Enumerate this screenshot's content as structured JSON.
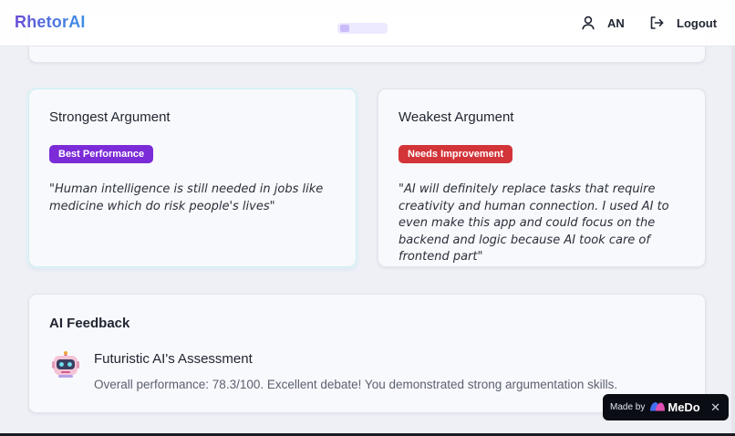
{
  "navbar": {
    "brand": "RhetorAI",
    "user_icon": "user-icon",
    "user_initials": "AN",
    "logout_icon": "logout-icon",
    "logout_label": "Logout"
  },
  "strongest": {
    "title": "Strongest Argument",
    "badge": "Best Performance",
    "badge_color": "#7c2bd8",
    "quote": "\"Human intelligence is still needed in jobs like medicine which do risk people's lives\""
  },
  "weakest": {
    "title": "Weakest Argument",
    "badge": "Needs Improvement",
    "badge_color": "#d23438",
    "quote": "\"AI will definitely replace tasks that require creativity and human connection. I used AI to even make this app and could focus on the backend and logic because AI took care of frontend part\""
  },
  "feedback": {
    "section_title": "AI Feedback",
    "avatar_icon": "robot-icon",
    "heading": "Futuristic AI's Assessment",
    "text": "Overall performance: 78.3/100. Excellent debate! You demonstrated strong argumentation skills."
  },
  "made_with": {
    "prefix": "Made by",
    "brand": "MeDo",
    "close": "✕"
  },
  "colors": {
    "brand_gradient_start": "#6a4bd6",
    "brand_gradient_end": "#3f8fe6",
    "background": "#eef0f6"
  }
}
